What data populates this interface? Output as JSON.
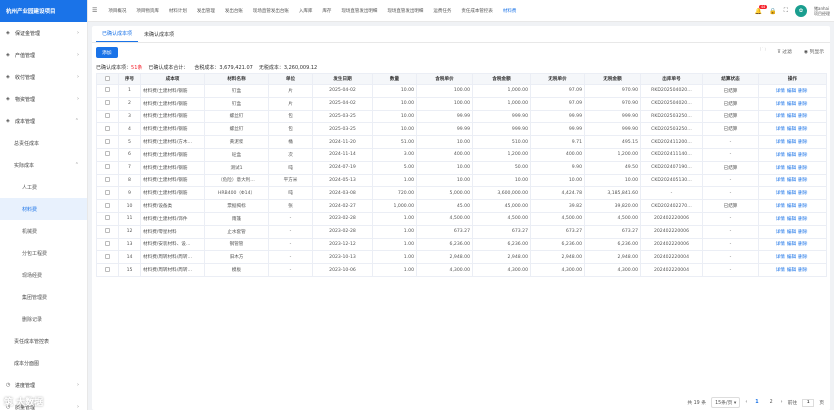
{
  "app": {
    "title": "杭州产业园建设项目"
  },
  "sidebar": {
    "items": [
      {
        "label": "保证金管理",
        "icon": "shield-icon",
        "expanded": false
      },
      {
        "label": "产值管理",
        "icon": "chart-icon",
        "expanded": false
      },
      {
        "label": "收付管理",
        "icon": "wallet-icon",
        "expanded": false
      },
      {
        "label": "物资管理",
        "icon": "box-icon",
        "expanded": false
      },
      {
        "label": "成本管理",
        "icon": "coin-icon",
        "expanded": true
      }
    ],
    "cost_children": [
      "总责任成本",
      "实际成本"
    ],
    "actual_children": [
      "人工费",
      "材料费",
      "机械费",
      "分包工程费",
      "现场经费",
      "集团管理费",
      "删除记录"
    ],
    "after": [
      "责任成本管控表",
      "成本分面图"
    ],
    "bottom": [
      {
        "label": "进度管理"
      },
      {
        "label": "质量管理"
      }
    ]
  },
  "header": {
    "tabs": [
      "项目概况",
      "项目物资库",
      "材料计划",
      "发出管理",
      "发出台账",
      "现场直管发出台账",
      "入库库",
      "库存",
      "现场直管发出明细",
      "现场直管发出明细",
      "运费任务",
      "责任成本管控表",
      "材料费"
    ],
    "notifications": "44",
    "user_name": "猪anhai",
    "user_sub": "项目经理"
  },
  "subtabs": [
    "已确认成本项",
    "未确认成本项"
  ],
  "toolbar": {
    "add": "添加",
    "filter": "过滤",
    "columns": "列显示"
  },
  "summary": {
    "label_count": "已确认成本项：",
    "count": "51条",
    "label_total": "已确认成本合计：",
    "tax_total": "含税成本：3,679,421.07",
    "notax_total": "无税成本：3,260,009.12"
  },
  "table": {
    "headers": [
      "",
      "序号",
      "成本项",
      "材料名称",
      "单位",
      "发生日期",
      "数量",
      "含税单价",
      "含税金额",
      "无税单价",
      "无税金额",
      "出库单号",
      "结算状态",
      "操作"
    ],
    "ops": [
      "详情",
      "编辑",
      "删除"
    ],
    "rows": [
      [
        "1",
        "材料费/土建材料/钢筋",
        "钉盒",
        "片",
        "2025-04-02",
        "10.00",
        "100.00",
        "1,000.00",
        "97.09",
        "970.90",
        "RKD202504020…",
        "已结算"
      ],
      [
        "2",
        "材料费/土建材料/钢筋",
        "钉盒",
        "片",
        "2025-04-02",
        "10.00",
        "100.00",
        "1,000.00",
        "97.09",
        "970.90",
        "CKD202504020…",
        "已结算"
      ],
      [
        "3",
        "材料费/土建材料/钢筋",
        "螺丝钉",
        "包",
        "2025-03-25",
        "10.00",
        "99.99",
        "999.90",
        "99.99",
        "999.90",
        "RKD202503250…",
        "已结算"
      ],
      [
        "4",
        "材料费/土建材料/钢筋",
        "螺丝钉",
        "包",
        "2025-03-25",
        "10.00",
        "99.99",
        "999.90",
        "99.99",
        "999.90",
        "CKD202503250…",
        "已结算"
      ],
      [
        "5",
        "材料费/土建材料/方木…",
        "黄泥浆",
        "桶",
        "2024-11-20",
        "51.00",
        "10.00",
        "510.00",
        "9.71",
        "495.15",
        "CKD202411200…",
        "-"
      ],
      [
        "6",
        "材料费/土建材料/钢筋",
        "砼盒",
        "次",
        "2024-11-14",
        "3.00",
        "400.00",
        "1,200.00",
        "400.00",
        "1,200.00",
        "CKD202411140…",
        "-"
      ],
      [
        "7",
        "材料费/土建材料/钢筋",
        "测试1",
        "吨",
        "2024-07-19",
        "5.00",
        "10.00",
        "50.00",
        "9.90",
        "49.50",
        "CKD202407190…",
        "已结算"
      ],
      [
        "8",
        "材料费/土建材料/钢筋",
        "（危险）意大利…",
        "平方米",
        "2024-05-13",
        "1.00",
        "10.00",
        "10.00",
        "10.00",
        "10.00",
        "CKD202405130…",
        "-"
      ],
      [
        "9",
        "材料费/土建材料/钢筋",
        "HRB400（Φ14）",
        "吨",
        "2024-03-08",
        "720.00",
        "5,000.00",
        "3,600,000.00",
        "4,424.78",
        "3,185,841.60",
        "-",
        "-"
      ],
      [
        "10",
        "材料费/设备类",
        "票据揭标",
        "张",
        "2024-02-27",
        "1,000.00",
        "45.00",
        "45,000.00",
        "39.82",
        "39,820.00",
        "CKD202402270…",
        "已结算"
      ],
      [
        "11",
        "材料费/土建材料/饰件",
        "雨篷",
        "-",
        "2023-02-28",
        "1.00",
        "4,500.00",
        "4,500.00",
        "4,500.00",
        "4,500.00",
        "202402220006",
        "-"
      ],
      [
        "12",
        "材料费/零星材料",
        "止水套管",
        "-",
        "2023-02-28",
        "1.00",
        "673.27",
        "673.27",
        "673.27",
        "673.27",
        "202402220006",
        "-"
      ],
      [
        "13",
        "材料费/安装材料、设…",
        "钢管管",
        "-",
        "2023-12-12",
        "1.00",
        "6,236.00",
        "6,236.00",
        "6,236.00",
        "6,236.00",
        "202402220006",
        "-"
      ],
      [
        "14",
        "材料费/周转材料/周转…",
        "旧木方",
        "-",
        "2023-10-13",
        "1.00",
        "2,948.00",
        "2,948.00",
        "2,948.00",
        "2,948.00",
        "202402220004",
        "-"
      ],
      [
        "15",
        "材料费/周转材料/周转…",
        "模板",
        "-",
        "2023-10-06",
        "1.00",
        "4,300.00",
        "4,300.00",
        "4,300.00",
        "4,300.00",
        "202402220004",
        "-"
      ]
    ]
  },
  "pager": {
    "total": "共 19 条",
    "size": "15条/页",
    "pages": [
      "1",
      "2"
    ],
    "current": "1",
    "goto": "前往",
    "page_unit": "页"
  },
  "watermark": "筑 大数据"
}
